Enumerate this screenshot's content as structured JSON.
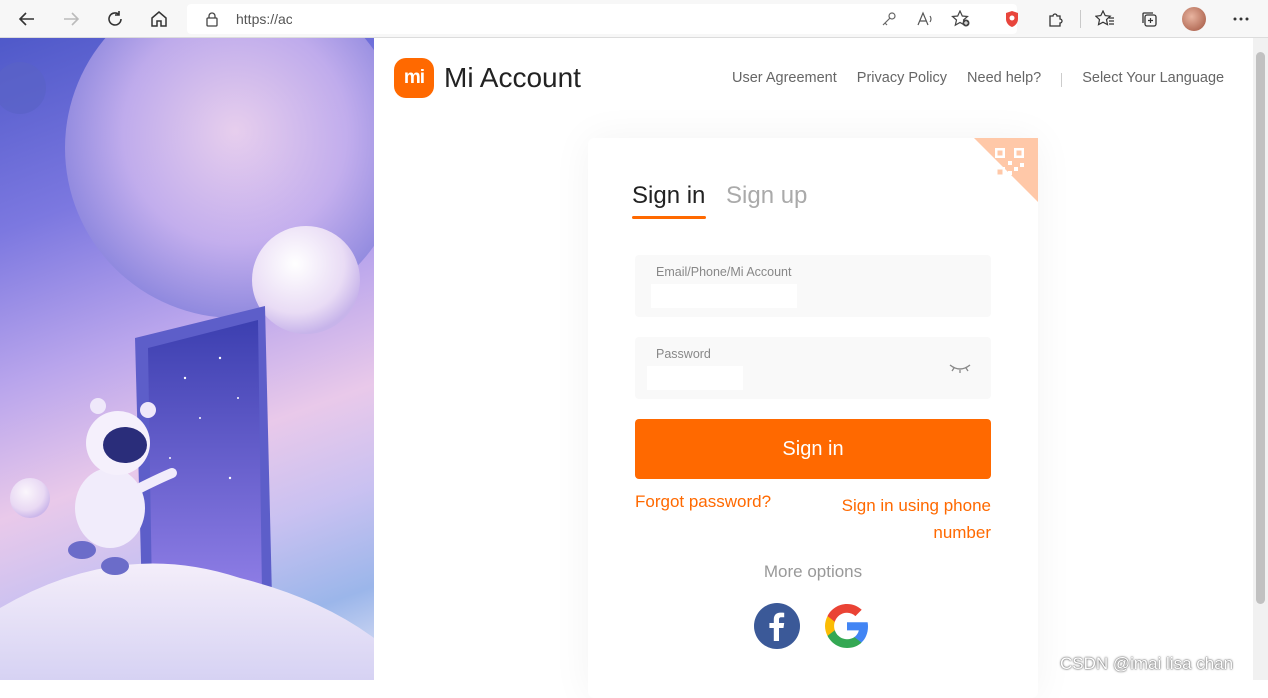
{
  "browser": {
    "url": "https://ac",
    "icons": [
      "back-icon",
      "forward-icon",
      "refresh-icon",
      "home-icon",
      "lock-icon",
      "key-icon",
      "read-aloud-icon",
      "favorite-add-icon",
      "shield-extension-icon",
      "extensions-icon",
      "favorites-icon",
      "collections-icon",
      "profile-avatar",
      "more-icon"
    ]
  },
  "header": {
    "brand_logo_text": "mi",
    "brand": "Mi Account",
    "links": [
      "User Agreement",
      "Privacy Policy",
      "Need help?"
    ],
    "language": "Select Your Language"
  },
  "card": {
    "tabs": {
      "signin": "Sign in",
      "signup": "Sign up"
    },
    "account_field": {
      "label": "Email/Phone/Mi Account",
      "value": ""
    },
    "password_field": {
      "label": "Password",
      "value": ""
    },
    "signin_button": "Sign in",
    "forgot": "Forgot password?",
    "phone_signin": "Sign in using phone number",
    "more_options": "More options",
    "social": [
      "facebook-icon",
      "google-icon"
    ]
  },
  "watermark": "CSDN @imai lisa chan",
  "colors": {
    "accent": "#ff6900",
    "facebook": "#3b5998"
  }
}
